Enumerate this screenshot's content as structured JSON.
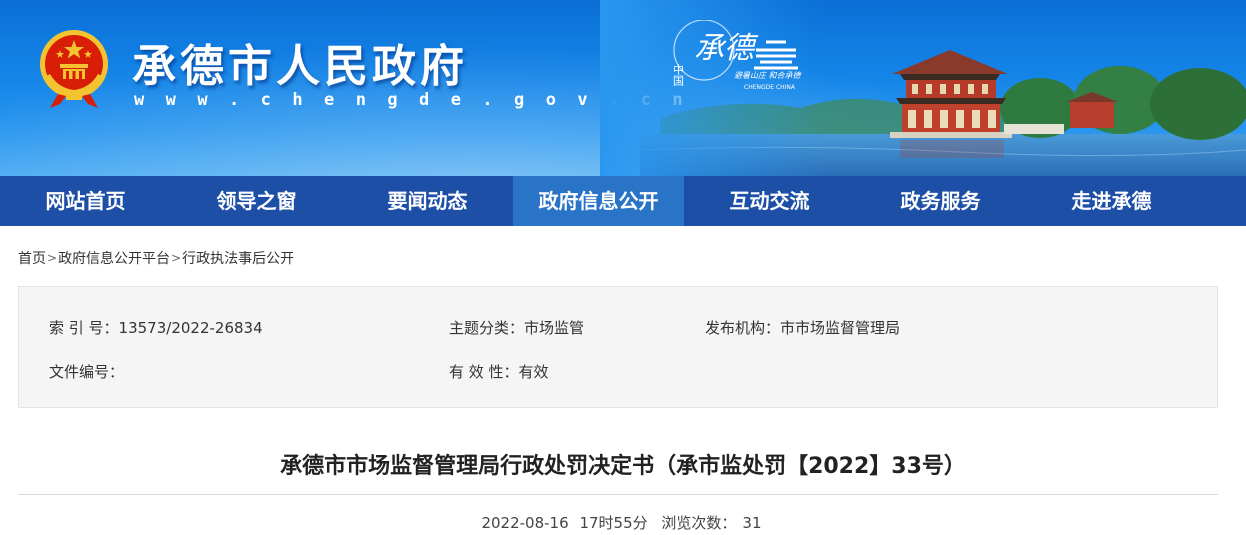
{
  "header": {
    "site_title": "承德市人民政府",
    "site_url": "w w w . c h e n g d e . g o v . c n",
    "logo": {
      "prefix": "中国",
      "name": "承德",
      "slogan": "避暑山庄 和合承德",
      "english": "CHENGDE CHINA"
    },
    "colors": {
      "banner": "#1585e8",
      "nav": "#1d4fa6",
      "nav_active": "#2a74c8"
    }
  },
  "nav": {
    "items": [
      {
        "label": "网站首页"
      },
      {
        "label": "领导之窗"
      },
      {
        "label": "要闻动态"
      },
      {
        "label": "政府信息公开",
        "active": true
      },
      {
        "label": "互动交流"
      },
      {
        "label": "政务服务"
      },
      {
        "label": "走进承德"
      }
    ]
  },
  "breadcrumb": {
    "items": [
      "首页",
      "政府信息公开平台",
      "行政执法事后公开"
    ],
    "separator": ">"
  },
  "meta": {
    "index_label": "索 引 号：",
    "index_value": "13573/2022-26834",
    "topic_label": "主题分类：",
    "topic_value": "市场监管",
    "publisher_label": "发布机构：",
    "publisher_value": "市市场监督管理局",
    "doc_no_label": "文件编号：",
    "doc_no_value": "",
    "validity_label": "有 效 性：",
    "validity_value": "有效"
  },
  "article": {
    "title": "承德市市场监督管理局行政处罚决定书（承市监处罚【2022】33号）",
    "date": "2022-08-16",
    "time": "17时55分",
    "views_label": "浏览次数：",
    "views": "31"
  }
}
